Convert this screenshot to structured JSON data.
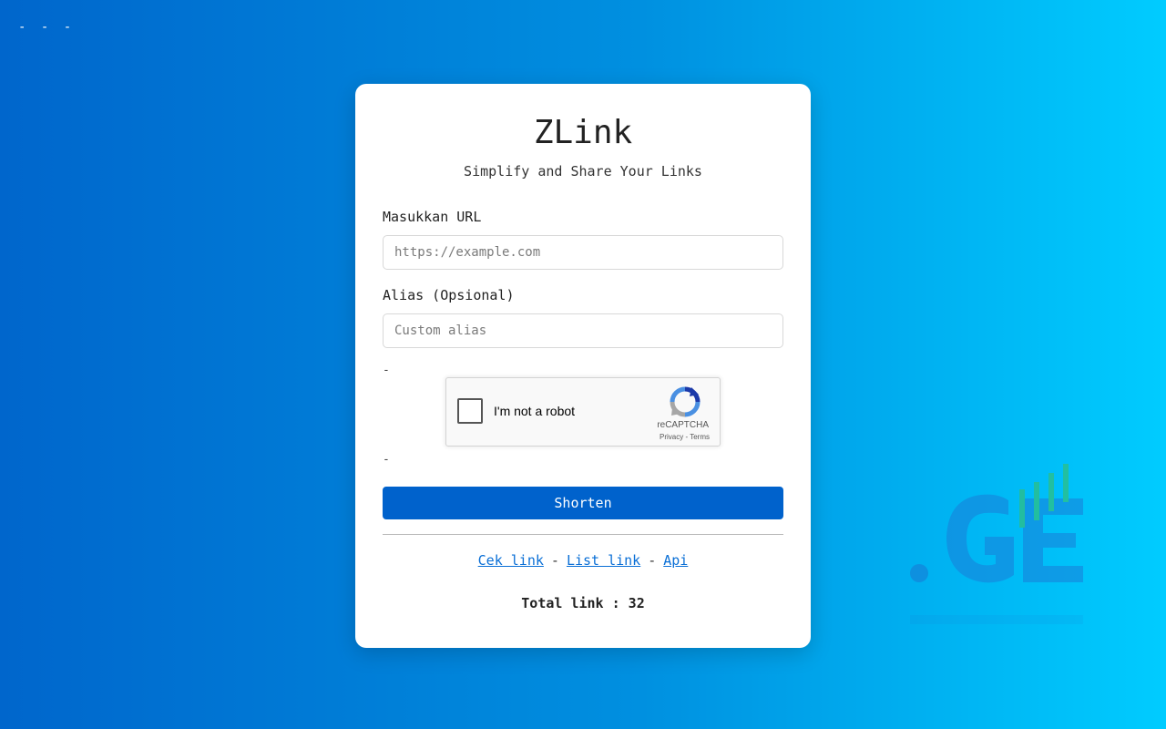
{
  "corner": {
    "text": "- - -"
  },
  "app": {
    "title": "ZLink",
    "subtitle": "Simplify and Share Your Links"
  },
  "form": {
    "url_label": "Masukkan URL",
    "url_placeholder": "https://example.com",
    "url_value": "",
    "alias_label": "Alias (Opsional)",
    "alias_placeholder": "Custom alias",
    "alias_value": "",
    "dash_top": "-",
    "dash_bottom": "-",
    "submit_label": "Shorten"
  },
  "captcha": {
    "label": "I'm not a robot",
    "brand": "reCAPTCHA",
    "privacy": "Privacy",
    "separator": " - ",
    "terms": "Terms",
    "icon": "recaptcha-logo-icon"
  },
  "footer_links": {
    "items": [
      {
        "label": "Cek link"
      },
      {
        "label": "List link"
      },
      {
        "label": "Api"
      }
    ],
    "separator": "-"
  },
  "stats": {
    "total_text": "Total link : 32"
  },
  "watermark": {
    "icon": "ge-logo-watermark-icon"
  },
  "colors": {
    "primary_button": "#0062cc",
    "link": "#0a6fd6",
    "bg_start": "#0066cc",
    "bg_end": "#00ccff"
  }
}
